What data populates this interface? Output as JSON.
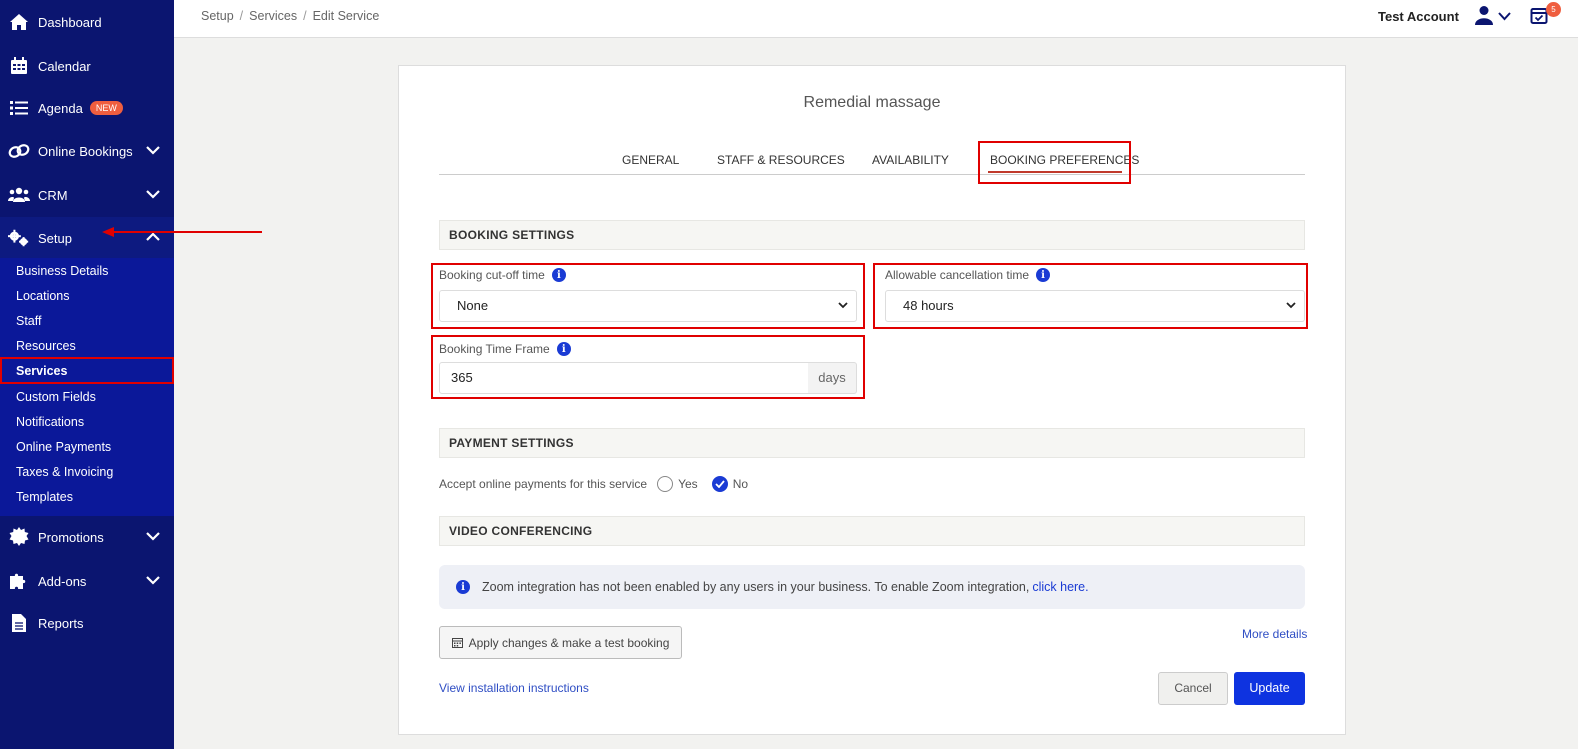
{
  "sidebar": {
    "items": [
      {
        "label": "Dashboard",
        "icon": "home-icon"
      },
      {
        "label": "Calendar",
        "icon": "calendar-icon"
      },
      {
        "label": "Agenda",
        "icon": "list-icon",
        "badge": "NEW"
      },
      {
        "label": "Online Bookings",
        "icon": "link-icon"
      },
      {
        "label": "CRM",
        "icon": "users-icon"
      },
      {
        "label": "Setup",
        "icon": "gears-icon"
      },
      {
        "label": "Promotions",
        "icon": "badge-icon"
      },
      {
        "label": "Add-ons",
        "icon": "puzzle-icon"
      },
      {
        "label": "Reports",
        "icon": "file-icon"
      }
    ],
    "setup_sub": [
      "Business Details",
      "Locations",
      "Staff",
      "Resources",
      "Services",
      "Custom Fields",
      "Notifications",
      "Online Payments",
      "Taxes & Invoicing",
      "Templates"
    ],
    "current_sub": "Services"
  },
  "topbar": {
    "breadcrumb": [
      "Setup",
      "Services",
      "Edit Service"
    ],
    "account": "Test Account",
    "notification_count": "5"
  },
  "service": {
    "title": "Remedial massage",
    "tabs": [
      "GENERAL",
      "STAFF & RESOURCES",
      "AVAILABILITY",
      "BOOKING PREFERENCES"
    ],
    "active_tab": "BOOKING PREFERENCES"
  },
  "booking_settings": {
    "header": "BOOKING SETTINGS",
    "cutoff_label": "Booking cut-off time",
    "cutoff_value": "None",
    "cancel_label": "Allowable cancellation time",
    "cancel_value": "48 hours",
    "timeframe_label": "Booking Time Frame",
    "timeframe_value": "365",
    "timeframe_unit": "days"
  },
  "payment_settings": {
    "header": "PAYMENT SETTINGS",
    "question": "Accept online payments for this service",
    "yes": "Yes",
    "no": "No",
    "selected": "No"
  },
  "video": {
    "header": "VIDEO CONFERENCING",
    "alert_text": "Zoom integration has not been enabled by any users in your business. To enable Zoom integration,",
    "alert_link": "click here."
  },
  "actions": {
    "test_booking": "Apply changes & make a test booking",
    "more_details": "More details",
    "install": "View installation instructions",
    "cancel": "Cancel",
    "update": "Update"
  },
  "colors": {
    "sidebar": "#0b1570",
    "submenu": "#0b1899",
    "primary": "#0e33e0",
    "annotation": "#e00000",
    "badge": "#ef5e3f"
  }
}
